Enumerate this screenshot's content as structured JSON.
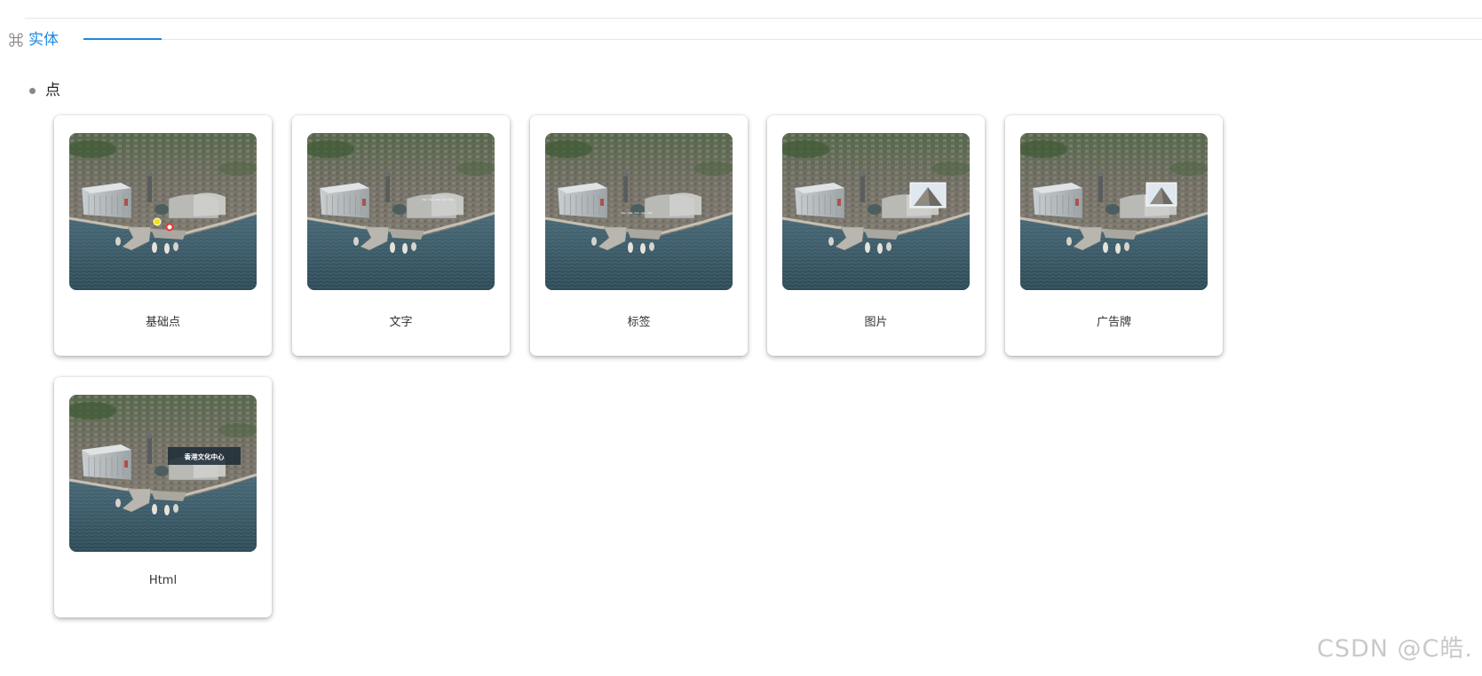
{
  "section": {
    "icon": "command-icon",
    "title": "实体"
  },
  "group": {
    "label": "点"
  },
  "cards": [
    {
      "label": "基础点",
      "overlay": "points"
    },
    {
      "label": "文字",
      "overlay": "text"
    },
    {
      "label": "标签",
      "overlay": "label"
    },
    {
      "label": "图片",
      "overlay": "image"
    },
    {
      "label": "广告牌",
      "overlay": "billboard"
    },
    {
      "label": "Html",
      "overlay": "html",
      "popup_text": "香港文化中心"
    }
  ],
  "watermark": "CSDN @C皓.",
  "colors": {
    "accent": "#1e88e5",
    "water": "#3a5968",
    "city": "#6b6a60"
  }
}
